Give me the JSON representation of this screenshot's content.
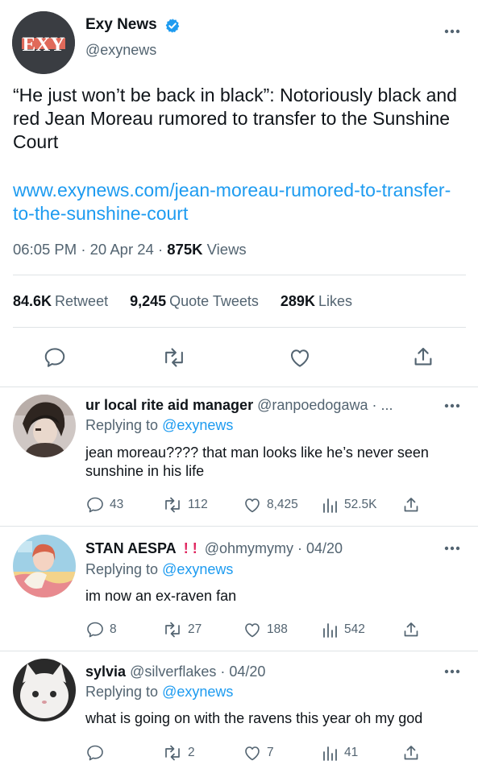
{
  "tweet": {
    "author_name": "Exy News",
    "handle": "@exynews",
    "avatar_text": "EXY",
    "text": "“He just won’t be back in black”: Notoriously black and red Jean Moreau rumored to transfer to the Sunshine Court",
    "link": "www.exynews.com/jean-moreau-rumored-to-transfer-to-the-sunshine-court",
    "time": "06:05 PM",
    "date": "20 Apr 24",
    "views_count": "875K",
    "views_label": "Views",
    "retweets_count": "84.6K",
    "retweets_label": "Retweet",
    "quotes_count": "9,245",
    "quotes_label": "Quote Tweets",
    "likes_count": "289K",
    "likes_label": "Likes"
  },
  "replies": [
    {
      "name": "ur local rite aid manager",
      "handle_meta": "@ranpoedogawa · ...",
      "replying_prefix": "Replying to",
      "replying_to": "@exynews",
      "text": "jean moreau???? that man looks like he’s never seen sunshine in his life",
      "replies": "43",
      "retweets": "112",
      "likes": "8,425",
      "views": "52.5K"
    },
    {
      "name": "STAN AESPA",
      "name_marks": "! !",
      "handle_meta": "@ohmymymy · 04/20",
      "replying_prefix": "Replying to",
      "replying_to": "@exynews",
      "text": "im now an ex-raven fan",
      "replies": "8",
      "retweets": "27",
      "likes": "188",
      "views": "542"
    },
    {
      "name": "sylvia",
      "handle_meta": "@silverflakes · 04/20",
      "replying_prefix": "Replying to",
      "replying_to": "@exynews",
      "text": "what is going on with the ravens this year oh my god",
      "replies": "",
      "retweets": "2",
      "likes": "7",
      "views": "41"
    }
  ],
  "icons": {
    "verified": "verified-badge-icon",
    "more": "more-options-icon",
    "reply": "reply-icon",
    "retweet": "retweet-icon",
    "like": "like-icon",
    "share": "share-icon",
    "views": "views-icon"
  },
  "colors": {
    "accent": "#1d9bf0",
    "text": "#0f1419",
    "muted": "#536471",
    "divider": "#dfe3e6",
    "logo_red": "#e06a5a",
    "excl": "#e0245e"
  }
}
